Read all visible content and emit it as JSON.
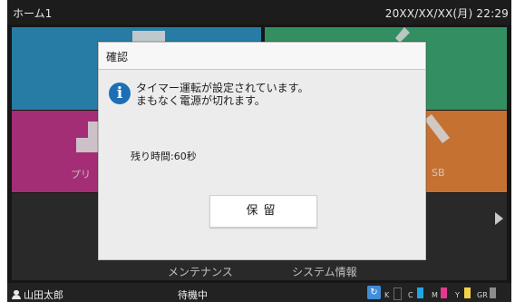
{
  "header": {
    "title": "ホーム1",
    "datetime": "20XX/XX/XX(月) 22:29"
  },
  "tiles": [
    {
      "name": "tile-1",
      "color": "#2f98c8",
      "label": ""
    },
    {
      "name": "tile-2",
      "color": "#3fae78",
      "label": ""
    },
    {
      "name": "tile-print",
      "color": "#c8398f",
      "label": "プリ"
    },
    {
      "name": "tile-usb",
      "color": "#f08a3c",
      "label": "SB"
    }
  ],
  "menu": {
    "maintenance": "メンテナンス",
    "system_info": "システム情報"
  },
  "status": {
    "user": "山田太郎",
    "state": "待機中",
    "inks": [
      {
        "label": "K",
        "color": "#202020"
      },
      {
        "label": "C",
        "color": "#1ea7e1"
      },
      {
        "label": "M",
        "color": "#e3398e"
      },
      {
        "label": "Y",
        "color": "#f3d24a"
      },
      {
        "label": "GR",
        "color": "#8c8c8c"
      }
    ]
  },
  "dialog": {
    "title": "確認",
    "message_line1": "タイマー運転が設定されています。",
    "message_line2": "まもなく電源が切れます。",
    "remaining": "残り時間:60秒",
    "hold_button": "保留"
  },
  "icons": {
    "info": "info-icon",
    "user": "user-icon",
    "next": "arrow-right-icon",
    "refresh": "refresh-icon"
  }
}
